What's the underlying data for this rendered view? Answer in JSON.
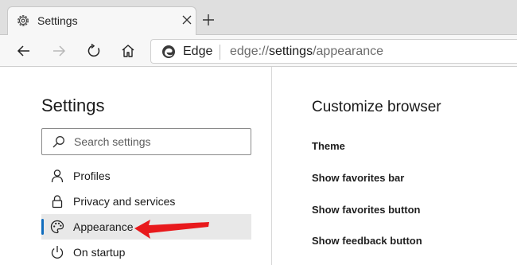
{
  "tab": {
    "title": "Settings",
    "icon": "gear-icon"
  },
  "toolbar": {
    "buttons": [
      "back-icon",
      "forward-icon",
      "refresh-icon",
      "home-icon"
    ],
    "browser_label": "Edge",
    "url_scheme": "edge://",
    "url_host": "settings",
    "url_path": "/appearance"
  },
  "sidebar": {
    "title": "Settings",
    "search_placeholder": "Search settings",
    "items": [
      {
        "label": "Profiles",
        "icon": "person-icon",
        "active": false
      },
      {
        "label": "Privacy and services",
        "icon": "lock-icon",
        "active": false
      },
      {
        "label": "Appearance",
        "icon": "palette-icon",
        "active": true
      },
      {
        "label": "On startup",
        "icon": "power-icon",
        "active": false
      }
    ]
  },
  "main": {
    "title": "Customize browser",
    "options": [
      "Theme",
      "Show favorites bar",
      "Show favorites button",
      "Show feedback button"
    ]
  },
  "colors": {
    "accent": "#0f6cbd",
    "annotation_arrow": "#e8191c"
  }
}
